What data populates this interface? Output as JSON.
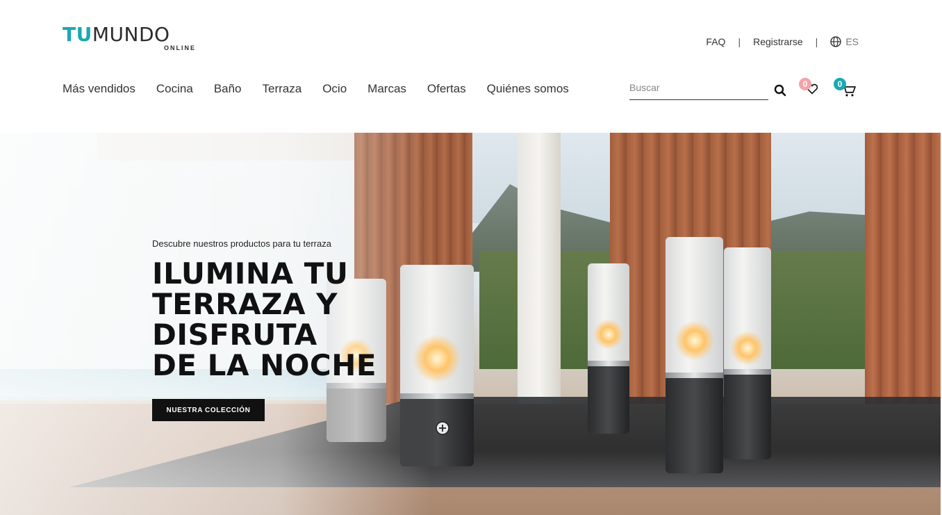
{
  "logo": {
    "part1": "TU",
    "part2": "MUNDO",
    "sub": "ONLINE"
  },
  "topnav": {
    "faq": "FAQ",
    "register": "Registrarse",
    "lang": "ES"
  },
  "mainnav": [
    "Más vendidos",
    "Cocina",
    "Baño",
    "Terraza",
    "Ocio",
    "Marcas",
    "Ofertas",
    "Quiénes somos"
  ],
  "search": {
    "placeholder": "Buscar"
  },
  "wishlist": {
    "count": "0"
  },
  "cart": {
    "count": "0"
  },
  "hero": {
    "subtitle": "Descubre nuestros productos para tu terraza",
    "title_lines": [
      "ILUMINA TU",
      "TERRAZA Y",
      "DISFRUTA",
      "DE LA NOCHE"
    ],
    "cta": "NUESTRA COLECCIÓN"
  },
  "colors": {
    "accent": "#1aa9b0",
    "badge_pink": "#f7a1a9",
    "cta_bg": "#111111"
  },
  "icons": [
    "globe-icon",
    "search-icon",
    "heart-icon",
    "cart-icon",
    "plus-icon"
  ]
}
